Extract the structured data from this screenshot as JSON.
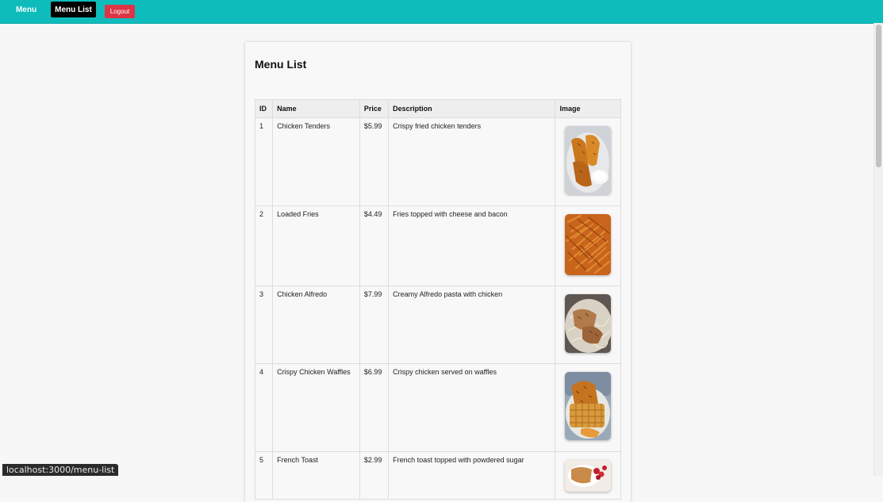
{
  "nav": {
    "menu_label": "Menu",
    "menu_list_label": "Menu List",
    "logout_label": "Logout"
  },
  "page": {
    "title": "Menu List"
  },
  "table": {
    "headers": {
      "id": "ID",
      "name": "Name",
      "price": "Price",
      "description": "Description",
      "image": "Image"
    },
    "rows": [
      {
        "id": "1",
        "name": "Chicken Tenders",
        "price": "$5.99",
        "description": "Crispy fried chicken tenders",
        "image_icon": "chicken-tenders-photo"
      },
      {
        "id": "2",
        "name": "Loaded Fries",
        "price": "$4.49",
        "description": "Fries topped with cheese and bacon",
        "image_icon": "loaded-fries-photo"
      },
      {
        "id": "3",
        "name": "Chicken Alfredo",
        "price": "$7.99",
        "description": "Creamy Alfredo pasta with chicken",
        "image_icon": "chicken-alfredo-photo"
      },
      {
        "id": "4",
        "name": "Crispy Chicken Waffles",
        "price": "$6.99",
        "description": "Crispy chicken served on waffles",
        "image_icon": "chicken-waffles-photo"
      },
      {
        "id": "5",
        "name": "French Toast",
        "price": "$2.99",
        "description": "French toast topped with powdered sugar",
        "image_icon": "french-toast-photo"
      }
    ]
  },
  "status_bar": {
    "url": "localhost:3000/menu-list"
  },
  "colors": {
    "navbar": "#0fbcbc",
    "active_nav": "#000000",
    "logout": "#dc3545"
  }
}
